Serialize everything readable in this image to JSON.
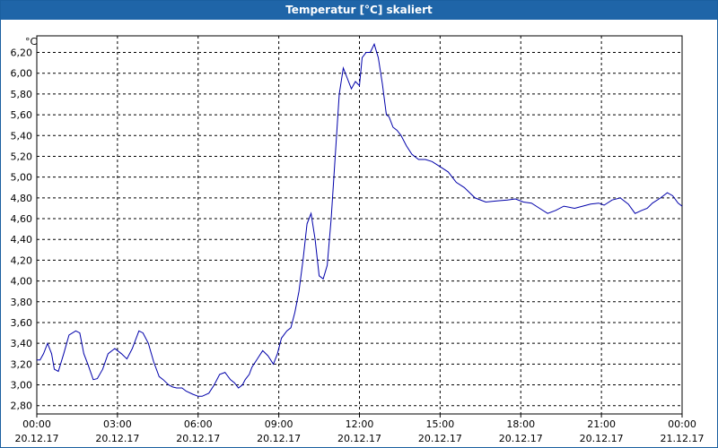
{
  "window": {
    "title": "Temperatur [°C] skaliert"
  },
  "chart_data": {
    "type": "line",
    "title": "Temperatur [°C] skaliert",
    "xlabel": "",
    "ylabel": "°C",
    "ylim": [
      2.72,
      6.36
    ],
    "xlim_hours": [
      0,
      24
    ],
    "grid": true,
    "y_ticks": [
      "2,80",
      "3,00",
      "3,20",
      "3,40",
      "3,60",
      "3,80",
      "4,00",
      "4,20",
      "4,40",
      "4,60",
      "4,80",
      "5,00",
      "5,20",
      "5,40",
      "5,60",
      "5,80",
      "6,00",
      "6,20"
    ],
    "x_ticks": [
      {
        "time": "00:00",
        "date": "20.12.17"
      },
      {
        "time": "03:00",
        "date": "20.12.17"
      },
      {
        "time": "06:00",
        "date": "20.12.17"
      },
      {
        "time": "09:00",
        "date": "20.12.17"
      },
      {
        "time": "12:00",
        "date": "20.12.17"
      },
      {
        "time": "15:00",
        "date": "20.12.17"
      },
      {
        "time": "18:00",
        "date": "20.12.17"
      },
      {
        "time": "21:00",
        "date": "20.12.17"
      },
      {
        "time": "00:00",
        "date": "21.12.17"
      }
    ],
    "series": [
      {
        "color": "#0000aa",
        "x": [
          0,
          0.12,
          0.25,
          0.4,
          0.55,
          0.65,
          0.8,
          1.0,
          1.2,
          1.45,
          1.6,
          1.75,
          1.9,
          2.1,
          2.25,
          2.45,
          2.65,
          2.9,
          3.0,
          3.15,
          3.35,
          3.55,
          3.8,
          3.95,
          4.15,
          4.35,
          4.55,
          4.7,
          4.9,
          5.05,
          5.2,
          5.4,
          5.55,
          5.8,
          6.0,
          6.15,
          6.4,
          6.6,
          6.8,
          7.0,
          7.2,
          7.35,
          7.5,
          7.65,
          7.75,
          7.9,
          8.0,
          8.2,
          8.4,
          8.6,
          8.8,
          8.95,
          9.1,
          9.3,
          9.45,
          9.6,
          9.75,
          9.9,
          10.05,
          10.2,
          10.35,
          10.5,
          10.65,
          10.8,
          10.95,
          11.1,
          11.25,
          11.4,
          11.55,
          11.7,
          11.85,
          12.0,
          12.1,
          12.25,
          12.4,
          12.55,
          12.7,
          12.85,
          13.0,
          13.1,
          13.25,
          13.4,
          13.55,
          13.75,
          13.95,
          14.2,
          14.45,
          14.7,
          15.0,
          15.3,
          15.6,
          15.9,
          16.3,
          16.7,
          17.1,
          17.5,
          17.8,
          18.1,
          18.4,
          18.7,
          19.0,
          19.3,
          19.6,
          20.0,
          20.3,
          20.6,
          20.9,
          21.1,
          21.4,
          21.7,
          22.0,
          22.25,
          22.5,
          22.7,
          22.9,
          23.2,
          23.45,
          23.65,
          23.85,
          24.0
        ],
        "y": [
          3.24,
          3.24,
          3.3,
          3.4,
          3.3,
          3.15,
          3.13,
          3.3,
          3.48,
          3.52,
          3.5,
          3.3,
          3.2,
          3.05,
          3.06,
          3.15,
          3.3,
          3.35,
          3.33,
          3.3,
          3.25,
          3.35,
          3.52,
          3.5,
          3.4,
          3.22,
          3.08,
          3.05,
          3.0,
          2.98,
          2.97,
          2.97,
          2.94,
          2.91,
          2.89,
          2.89,
          2.92,
          3.0,
          3.1,
          3.12,
          3.05,
          3.02,
          2.97,
          3.0,
          3.05,
          3.1,
          3.17,
          3.25,
          3.33,
          3.28,
          3.2,
          3.3,
          3.45,
          3.52,
          3.55,
          3.7,
          3.9,
          4.2,
          4.55,
          4.65,
          4.4,
          4.05,
          4.02,
          4.15,
          4.6,
          5.2,
          5.8,
          6.05,
          5.95,
          5.85,
          5.92,
          5.88,
          6.15,
          6.2,
          6.2,
          6.28,
          6.15,
          5.9,
          5.6,
          5.58,
          5.48,
          5.45,
          5.4,
          5.3,
          5.22,
          5.17,
          5.17,
          5.15,
          5.1,
          5.05,
          4.95,
          4.9,
          4.8,
          4.76,
          4.77,
          4.78,
          4.79,
          4.76,
          4.75,
          4.7,
          4.65,
          4.68,
          4.72,
          4.7,
          4.72,
          4.74,
          4.75,
          4.73,
          4.78,
          4.8,
          4.74,
          4.65,
          4.68,
          4.7,
          4.75,
          4.8,
          4.85,
          4.82,
          4.75,
          4.72
        ]
      }
    ]
  }
}
